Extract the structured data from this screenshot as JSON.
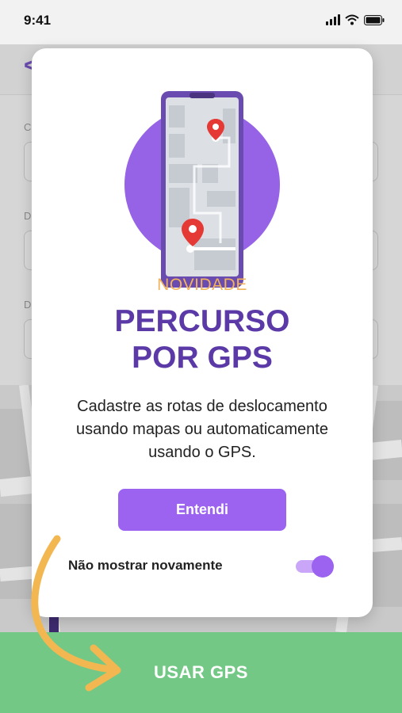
{
  "status_bar": {
    "time": "9:41"
  },
  "background_screen": {
    "back_label": "<",
    "field_labels": [
      "C",
      "D",
      "D"
    ]
  },
  "modal": {
    "eyebrow": "NOVIDADE",
    "title_line1": "PERCURSO",
    "title_line2": "POR GPS",
    "description": "Cadastre  as rotas de deslocamento usando mapas ou automaticamente usando o GPS.",
    "primary_button": "Entendi",
    "dont_show_label": "Não mostrar novamente",
    "dont_show_enabled": true
  },
  "bottom_action": {
    "label": "USAR GPS"
  },
  "colors": {
    "brand_purple": "#5b3aa7",
    "button_purple": "#9b63f0",
    "accent_orange": "#f2b35a",
    "cta_green": "#73c885"
  }
}
